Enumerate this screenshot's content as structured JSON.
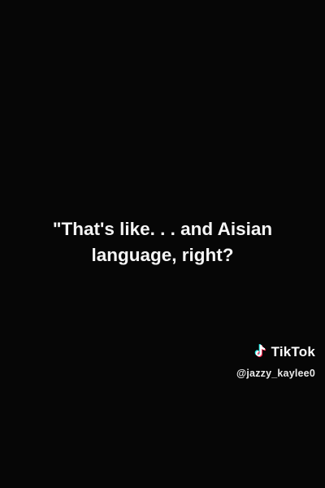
{
  "caption": {
    "line1": "\"That's like. . . and Aisian",
    "line2": "language, right?"
  },
  "watermark": {
    "brand": "TikTok",
    "handle": "@jazzy_kaylee0",
    "icon": "tiktok-logo-icon",
    "colors": {
      "cyan": "#25F4EE",
      "red": "#FE2C55",
      "white": "#FFFFFF"
    }
  },
  "background_color": "#060606"
}
